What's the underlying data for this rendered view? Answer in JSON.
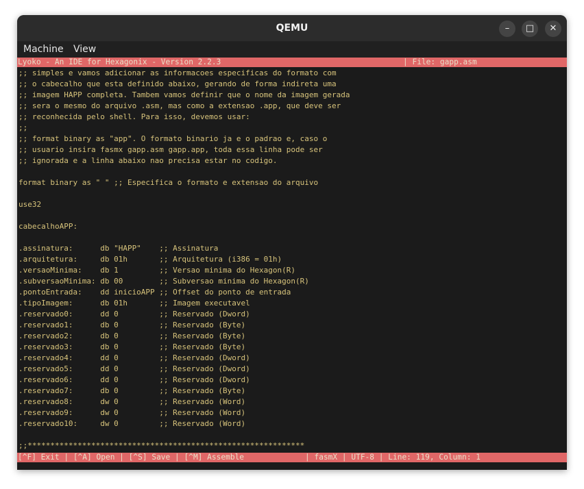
{
  "window": {
    "title": "QEMU",
    "minimize_glyph": "–",
    "maximize_glyph": "□",
    "close_glyph": "✕"
  },
  "menu": {
    "machine": "Machine",
    "view": "View"
  },
  "editor": {
    "header_title": "Lyoko - An IDE for Hexagonix - Version 2.2.3",
    "header_file": "| File: gapp.asm",
    "lines": [
      ";; simples e vamos adicionar as informacoes especificas do formato com",
      ";; o cabecalho que esta definido abaixo, gerando de forma indireta uma",
      ";; imagem HAPP completa. Tambem vamos definir que o nome da imagem gerada",
      ";; sera o mesmo do arquivo .asm, mas como a extensao .app, que deve ser",
      ";; reconhecida pelo shell. Para isso, devemos usar:",
      ";;",
      ";; format binary as \"app\". O formato binario ja e o padrao e, caso o",
      ";; usuario insira fasmx gapp.asm gapp.app, toda essa linha pode ser",
      ";; ignorada e a linha abaixo nao precisa estar no codigo.",
      "",
      "format binary as \" \" ;; Especifica o formato e extensao do arquivo",
      "",
      "use32",
      "",
      "cabecalhoAPP:",
      "",
      ".assinatura:      db \"HAPP\"    ;; Assinatura",
      ".arquitetura:     db 01h       ;; Arquitetura (i386 = 01h)",
      ".versaoMinima:    db 1         ;; Versao minima do Hexagon(R)",
      ".subversaoMinima: db 00        ;; Subversao minima do Hexagon(R)",
      ".pontoEntrada:    dd inicioAPP ;; Offset do ponto de entrada",
      ".tipoImagem:      db 01h       ;; Imagem executavel",
      ".reservado0:      dd 0         ;; Reservado (Dword)",
      ".reservado1:      db 0         ;; Reservado (Byte)",
      ".reservado2:      db 0         ;; Reservado (Byte)",
      ".reservado3:      db 0         ;; Reservado (Byte)",
      ".reservado4:      dd 0         ;; Reservado (Dword)",
      ".reservado5:      dd 0         ;; Reservado (Dword)",
      ".reservado6:      dd 0         ;; Reservado (Dword)",
      ".reservado7:      db 0         ;; Reservado (Byte)",
      ".reservado8:      dw 0         ;; Reservado (Word)",
      ".reservado9:      dw 0         ;; Reservado (Word)",
      ".reservado10:     dw 0         ;; Reservado (Word)",
      "",
      ";;*************************************************************"
    ],
    "status": {
      "shortcuts": "[^F] Exit | [^A] Open | [^S] Save | [^M] Assemble",
      "info": "| fasmX | UTF-8 | Line: 119, Column: 1"
    }
  },
  "colors": {
    "bar_background": "#e06767",
    "bar_text": "#eadfc8",
    "code_text": "#d7c37b",
    "screen_background": "#1b1b1b",
    "titlebar_background": "#2c2c2c"
  }
}
